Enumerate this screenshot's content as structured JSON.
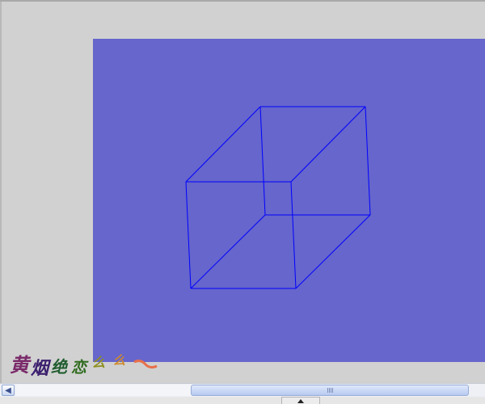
{
  "window": {
    "background": "#d1d1d1",
    "panel_color": "#6666cc",
    "wire_color": "#0000ff"
  },
  "drawing": {
    "shape": "wireframe-cube"
  },
  "watermark": {
    "text": "黄烟绝恋么么",
    "style": "colorful calligraphy signature"
  },
  "scrollbar": {
    "left_arrow_icon": "chevron-left-icon",
    "thumb_grip_icon": "grip-icon"
  },
  "splitter": {
    "icon": "triangle-up-icon"
  }
}
